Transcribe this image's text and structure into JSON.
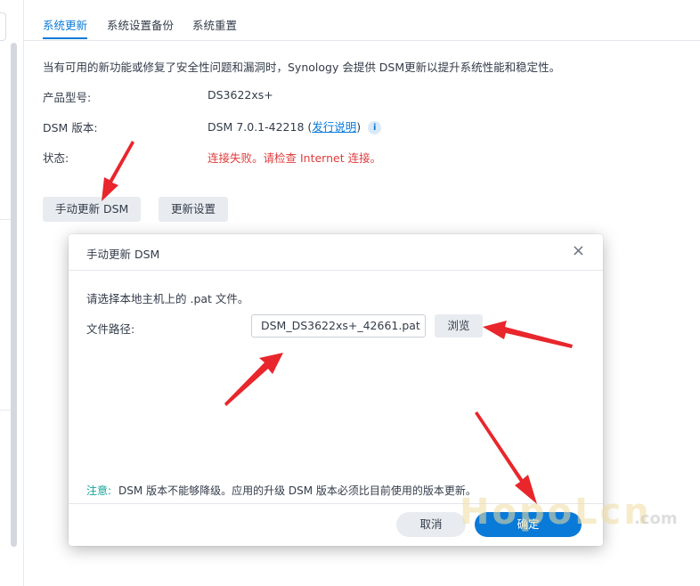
{
  "tabs": [
    {
      "label": "系统更新",
      "active": true
    },
    {
      "label": "系统设置备份",
      "active": false
    },
    {
      "label": "系统重置",
      "active": false
    }
  ],
  "main": {
    "description": "当有可用的新功能或修复了安全性问题和漏洞时，Synology 会提供 DSM更新以提升系统性能和稳定性。",
    "model_label": "产品型号:",
    "model_value": "DS3622xs+",
    "dsm_label": "DSM 版本:",
    "dsm_value_prefix": "DSM 7.0.1-42218 (",
    "release_notes_link": "发行说明",
    "dsm_value_suffix": ")",
    "info_icon_glyph": "i",
    "status_label": "状态:",
    "status_value": "连接失败。请检查 Internet 连接。",
    "manual_update_button": "手动更新 DSM",
    "update_settings_button": "更新设置"
  },
  "dialog": {
    "title": "手动更新 DSM",
    "close_glyph": "×",
    "instruction": "请选择本地主机上的 .pat 文件。",
    "file_path_label": "文件路径:",
    "file_path_value": "DSM_DS3622xs+_42661.pat",
    "browse_button": "浏览",
    "note_label": "注意:",
    "note_text": "DSM 版本不能够降级。应用的升级 DSM 版本必须比目前使用的版本更新。",
    "cancel_button": "取消",
    "ok_button": "确定"
  },
  "watermark": {
    "text": "HopoLcn",
    "suffix": ".com"
  },
  "colors": {
    "accent": "#0a7ad9",
    "error": "#e03c3c",
    "note": "#16a39a",
    "arrow": "#e8262b"
  }
}
